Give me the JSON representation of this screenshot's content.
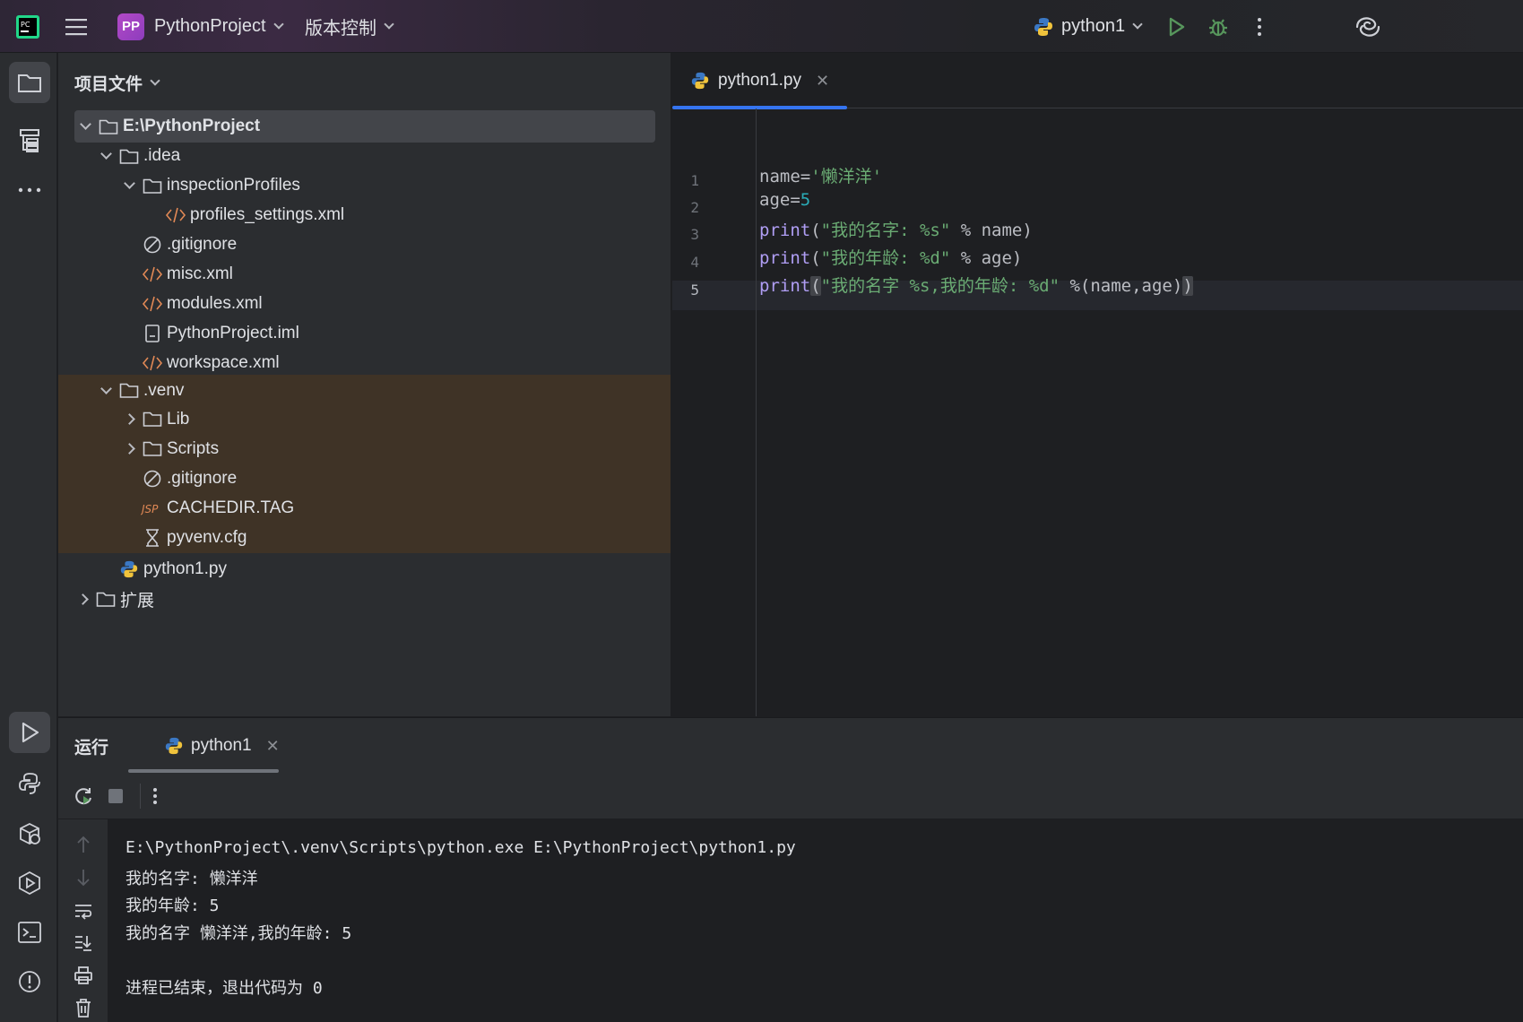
{
  "titlebar": {
    "project_badge": "PP",
    "project_name": "PythonProject",
    "vcs_label": "版本控制",
    "run_config": "python1",
    "accent_color": "#3574f0"
  },
  "project_panel": {
    "header": "项目文件",
    "tree": [
      {
        "label": "E:\\PythonProject",
        "icon": "folder-icon",
        "expanded": true
      },
      {
        "label": ".idea",
        "icon": "folder-icon",
        "expanded": true
      },
      {
        "label": "inspectionProfiles",
        "icon": "folder-icon",
        "expanded": true
      },
      {
        "label": "profiles_settings.xml",
        "icon": "xml-file-icon"
      },
      {
        "label": ".gitignore",
        "icon": "gitignore-file-icon"
      },
      {
        "label": "misc.xml",
        "icon": "xml-file-icon"
      },
      {
        "label": "modules.xml",
        "icon": "xml-file-icon"
      },
      {
        "label": "PythonProject.iml",
        "icon": "iml-file-icon"
      },
      {
        "label": "workspace.xml",
        "icon": "xml-file-icon"
      },
      {
        "label": ".venv",
        "icon": "folder-icon",
        "expanded": true
      },
      {
        "label": "Lib",
        "icon": "folder-icon",
        "expanded": false
      },
      {
        "label": "Scripts",
        "icon": "folder-icon",
        "expanded": false
      },
      {
        "label": ".gitignore",
        "icon": "gitignore-file-icon"
      },
      {
        "label": "CACHEDIR.TAG",
        "icon": "tag-file-icon"
      },
      {
        "label": "pyvenv.cfg",
        "icon": "cfg-file-icon"
      },
      {
        "label": "python1.py",
        "icon": "python-file-icon"
      },
      {
        "label": "扩展",
        "icon": "folder-icon",
        "expanded": false
      }
    ]
  },
  "editor": {
    "tab_label": "python1.py",
    "line_numbers": [
      "1",
      "2",
      "3",
      "4",
      "5"
    ],
    "lines": [
      [
        "name=",
        "'懒洋洋'"
      ],
      [
        "age=",
        "5"
      ],
      [
        "print",
        "(",
        "\"我的名字: %s\"",
        " % name)"
      ],
      [
        "print",
        "(",
        "\"我的年龄: %d\"",
        " % age)"
      ],
      [
        "print",
        "(",
        "\"我的名字 %s,我的年龄: %d\"",
        " %(name,age)",
        ")"
      ]
    ]
  },
  "run_panel": {
    "title": "运行",
    "tab_label": "python1",
    "output": [
      "E:\\PythonProject\\.venv\\Scripts\\python.exe E:\\PythonProject\\python1.py",
      "我的名字: 懒洋洋",
      "我的年龄: 5",
      "我的名字 懒洋洋,我的年龄: 5",
      "",
      "进程已结束，退出代码为 0"
    ]
  }
}
